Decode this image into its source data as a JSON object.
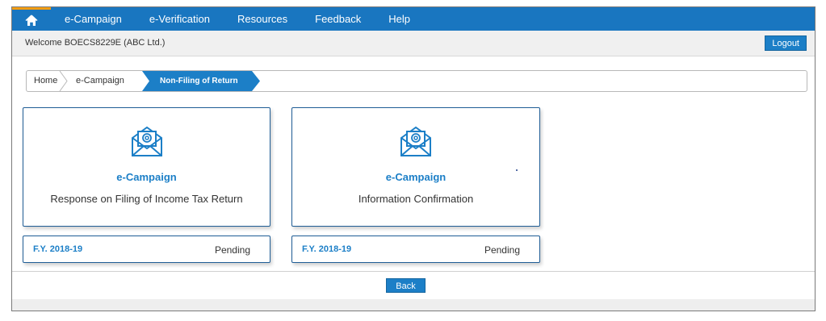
{
  "nav": {
    "items": [
      "e-Campaign",
      "e-Verification",
      "Resources",
      "Feedback",
      "Help"
    ]
  },
  "welcome": {
    "text": "Welcome BOECS8229E (ABC Ltd.)",
    "logout_label": "Logout"
  },
  "breadcrumb": {
    "items": [
      "Home",
      "e-Campaign"
    ],
    "active": "Non-Filing of Return"
  },
  "cards": [
    {
      "icon": "email-at-icon",
      "title": "e-Campaign",
      "subtitle": "Response on Filing of Income Tax Return",
      "fy": "F.Y. 2018-19",
      "status": "Pending"
    },
    {
      "icon": "email-at-icon",
      "title": "e-Campaign",
      "subtitle": "Information Confirmation",
      "fy": "F.Y. 2018-19",
      "status": "Pending"
    }
  ],
  "actions": {
    "back_label": "Back"
  },
  "colors": {
    "nav_bg": "#1976c0",
    "accent": "#1c7fc7",
    "card_border": "#1f5d95",
    "home_accent": "#f39c12"
  }
}
